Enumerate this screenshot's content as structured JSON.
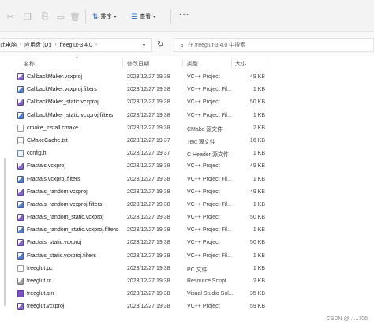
{
  "toolbar": {
    "sort_label": "排序",
    "view_label": "查看",
    "more_label": "···"
  },
  "address": {
    "segments": [
      "此电脑",
      "应用盘 (D:)",
      "freeglut-3.4.0"
    ]
  },
  "search": {
    "placeholder": "在 freeglut-3.4.0 中搜索"
  },
  "columns": {
    "name": "名称",
    "date": "修改日期",
    "type": "类型",
    "size": "大小"
  },
  "files": [
    {
      "name": "CallbackMaker.vcxproj",
      "date": "2023/12/27 19:38",
      "type": "VC++ Project",
      "size": "49 KB",
      "icon": "vc"
    },
    {
      "name": "CallbackMaker.vcxproj.filters",
      "date": "2023/12/27 19:38",
      "type": "VC++ Project Fil...",
      "size": "1 KB",
      "icon": "filter"
    },
    {
      "name": "CallbackMaker_static.vcxproj",
      "date": "2023/12/27 19:38",
      "type": "VC++ Project",
      "size": "50 KB",
      "icon": "vc"
    },
    {
      "name": "CallbackMaker_static.vcxproj.filters",
      "date": "2023/12/27 19:38",
      "type": "VC++ Project Fil...",
      "size": "1 KB",
      "icon": "filter"
    },
    {
      "name": "cmake_install.cmake",
      "date": "2023/12/27 19:38",
      "type": "CMake 源文件",
      "size": "2 KB",
      "icon": "doc"
    },
    {
      "name": "CMakeCache.txt",
      "date": "2023/12/27 19:37",
      "type": "Text 源文件",
      "size": "16 KB",
      "icon": "txt"
    },
    {
      "name": "config.h",
      "date": "2023/12/27 19:37",
      "type": "C Header 源文件",
      "size": "1 KB",
      "icon": "h"
    },
    {
      "name": "Fractals.vcxproj",
      "date": "2023/12/27 19:38",
      "type": "VC++ Project",
      "size": "49 KB",
      "icon": "vc"
    },
    {
      "name": "Fractals.vcxproj.filters",
      "date": "2023/12/27 19:38",
      "type": "VC++ Project Fil...",
      "size": "1 KB",
      "icon": "filter"
    },
    {
      "name": "Fractals_random.vcxproj",
      "date": "2023/12/27 19:38",
      "type": "VC++ Project",
      "size": "49 KB",
      "icon": "vc"
    },
    {
      "name": "Fractals_random.vcxproj.filters",
      "date": "2023/12/27 19:38",
      "type": "VC++ Project Fil...",
      "size": "1 KB",
      "icon": "filter"
    },
    {
      "name": "Fractals_random_static.vcxproj",
      "date": "2023/12/27 19:38",
      "type": "VC++ Project",
      "size": "50 KB",
      "icon": "vc"
    },
    {
      "name": "Fractals_random_static.vcxproj.filters",
      "date": "2023/12/27 19:38",
      "type": "VC++ Project Fil...",
      "size": "1 KB",
      "icon": "filter"
    },
    {
      "name": "Fractals_static.vcxproj",
      "date": "2023/12/27 19:38",
      "type": "VC++ Project",
      "size": "50 KB",
      "icon": "vc"
    },
    {
      "name": "Fractals_static.vcxproj.filters",
      "date": "2023/12/27 19:38",
      "type": "VC++ Project Fil...",
      "size": "1 KB",
      "icon": "filter"
    },
    {
      "name": "freeglut.pc",
      "date": "2023/12/27 19:38",
      "type": "PC 文件",
      "size": "1 KB",
      "icon": "doc"
    },
    {
      "name": "freeglut.rc",
      "date": "2023/12/27 19:38",
      "type": "Resource Script",
      "size": "2 KB",
      "icon": "rc"
    },
    {
      "name": "freeglut.sln",
      "date": "2023/12/27 19:38",
      "type": "Visual Studio Sol...",
      "size": "35 KB",
      "icon": "sln"
    },
    {
      "name": "freeglut.vcxproj",
      "date": "2023/12/27 19:38",
      "type": "VC++ Project",
      "size": "59 KB",
      "icon": "vc"
    }
  ],
  "watermark": "CSDN @......705"
}
